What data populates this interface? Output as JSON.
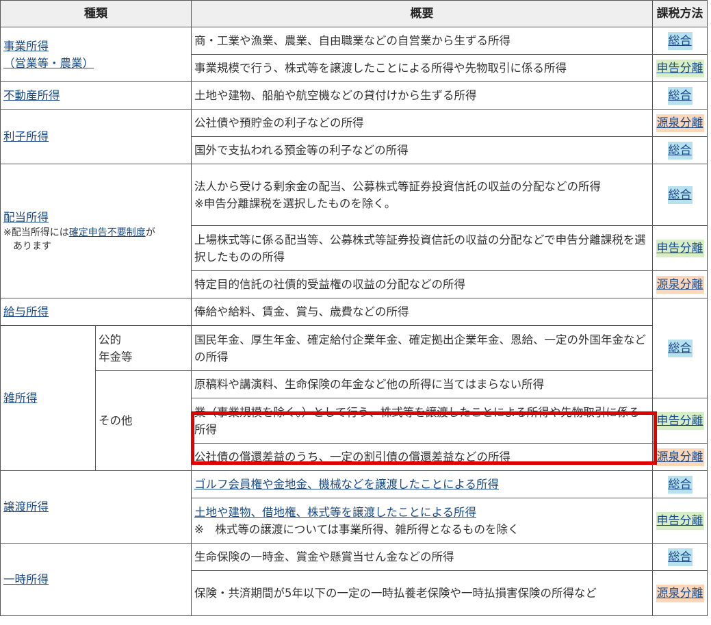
{
  "headers": {
    "type": "種類",
    "summary": "概要",
    "method": "課税方法"
  },
  "tax_labels": {
    "sogo": "総合",
    "shinkoku": "申告分離",
    "gensen": "源泉分離"
  },
  "colors": {
    "sogo": "#b7e1ef",
    "shinkoku": "#d8efc6",
    "gensen": "#fbd6b8",
    "highlight": "#e00000"
  },
  "rows": {
    "jigyo": {
      "type_line1": "事業所得",
      "type_line2": "（営業等・農業）",
      "r1": "商・工業や漁業、農業、自由職業などの自営業から生ずる所得",
      "r2": "事業規模で行う、株式等を譲渡したことによる所得や先物取引に係る所得"
    },
    "fudosan": {
      "type": "不動産所得",
      "r1": "土地や建物、船舶や航空機などの貸付けから生ずる所得"
    },
    "rishi": {
      "type": "利子所得",
      "r1": "公社債や預貯金の利子などの所得",
      "r2": "国外で支払われる預金等の利子などの所得"
    },
    "haito": {
      "type": "配当所得",
      "note_prefix": "※配当所得には",
      "note_link": "確定申告不要制度",
      "note_suffix": "が",
      "note_line2": "あります",
      "r1_line1": "法人から受ける剰余金の配当、公募株式等証券投資信託の収益の分配などの所得",
      "r1_line2": "※申告分離課税を選択したものを除く。",
      "r2": "上場株式等に係る配当等、公募株式等証券投資信託の収益の分配などで申告分離課税を選択したものの所得",
      "r3": "特定目的信託の社債的受益権の収益の分配などの所得"
    },
    "kyuyo": {
      "type": "給与所得",
      "r1": "俸給や給料、賃金、賞与、歳費などの所得"
    },
    "zatsu": {
      "type": "雑所得",
      "sub1_line1": "公的",
      "sub1_line2": "年金等",
      "sub1_r1": "国民年金、厚生年金、確定給付企業年金、確定拠出企業年金、恩給、一定の外国年金などの所得",
      "sub2": "その他",
      "sub2_r1": "原稿料や講演料、生命保険の年金など他の所得に当てはまらない所得",
      "sub2_r2": "業（事業規模を除く。）として行う、株式等を譲渡したことによる所得や先物取引に係る所得",
      "sub2_r3": "公社債の償還差益のうち、一定の割引債の償還差益などの所得"
    },
    "joto": {
      "type": "譲渡所得",
      "r1": "ゴルフ会員権や金地金、機械などを譲渡したことによる所得",
      "r2_link": "土地や建物、借地権、株式等を譲渡したことによる所得",
      "r2_note": "※　株式等の譲渡については事業所得、雑所得となるものを除く"
    },
    "ichiji": {
      "type": "一時所得",
      "r1": "生命保険の一時金、賞金や懸賞当せん金などの所得",
      "r2": "保険・共済期間が5年以下の一定の一時払養老保険や一時払損害保険の所得など"
    }
  }
}
